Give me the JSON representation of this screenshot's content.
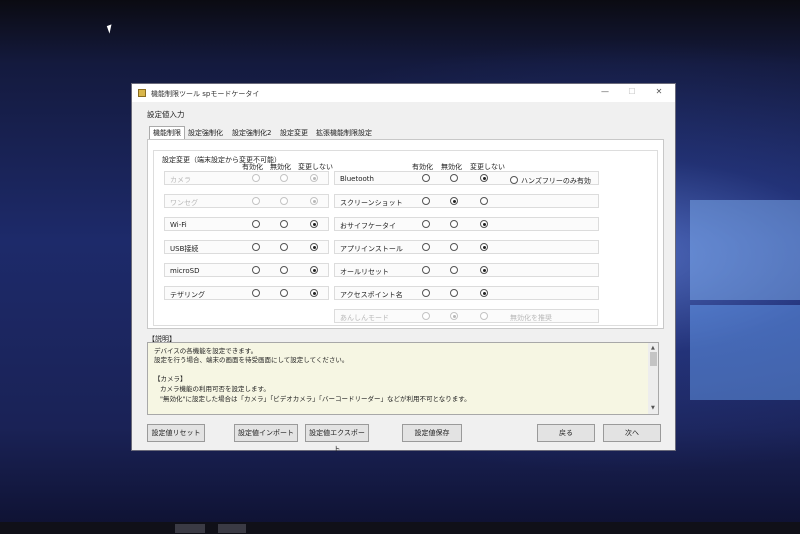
{
  "window": {
    "title": "機能制限ツール spモードケータイ",
    "controls": {
      "minimize": "—",
      "maximize": "☐",
      "close": "✕"
    }
  },
  "group_title": "設定値入力",
  "tabs": [
    "機能制限",
    "設定強制化",
    "設定強制化2",
    "設定変更",
    "拡張機能制限設定"
  ],
  "panel": {
    "title": "設定変更（端末設定から変更不可能）",
    "headers": {
      "enable": "有効化",
      "disable": "無効化",
      "nochange": "変更しない"
    }
  },
  "left_rows": [
    {
      "label": "カメラ",
      "selected": 2,
      "disabled": true
    },
    {
      "label": "ワンセグ",
      "selected": 2,
      "disabled": true
    },
    {
      "label": "Wi-Fi",
      "selected": 2,
      "disabled": false
    },
    {
      "label": "USB接続",
      "selected": 2,
      "disabled": false
    },
    {
      "label": "microSD",
      "selected": 2,
      "disabled": false
    },
    {
      "label": "テザリング",
      "selected": 2,
      "disabled": false
    }
  ],
  "right_rows": [
    {
      "label": "Bluetooth",
      "selected": 2,
      "disabled": false
    },
    {
      "label": "スクリーンショット",
      "selected": 1,
      "disabled": false
    },
    {
      "label": "おサイフケータイ",
      "selected": 2,
      "disabled": false
    },
    {
      "label": "アプリインストール",
      "selected": 2,
      "disabled": false
    },
    {
      "label": "オールリセット",
      "selected": 2,
      "disabled": false
    },
    {
      "label": "アクセスポイント名",
      "selected": 2,
      "disabled": false
    },
    {
      "label": "あんしんモード",
      "selected": 1,
      "disabled": true
    }
  ],
  "extra_options": {
    "handsfree": "ハンズフリーのみ有効",
    "disable_recommended": "無効化を推奨"
  },
  "description": {
    "label": "【説明】",
    "lines": [
      "デバイスの各機能を設定できます。",
      "設定を行う場合、端末の画面を待受画面にして設定してください。",
      "",
      "【カメラ】",
      "カメラ機能の利用可否を設定します。",
      "\"無効化\"に設定した場合は「カメラ」「ビデオカメラ」「バーコードリーダー」などが利用不可となります。"
    ]
  },
  "buttons": {
    "reset": "設定値リセット",
    "import": "設定値インポート",
    "export": "設定値エクスポート",
    "save": "設定値保存",
    "back": "戻る",
    "next": "次へ"
  }
}
